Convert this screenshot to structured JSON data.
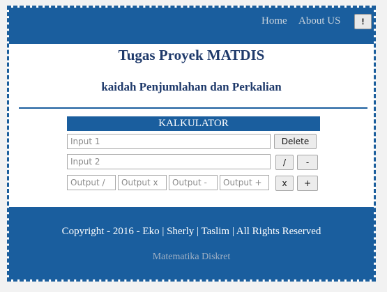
{
  "nav": {
    "home": "Home",
    "about": "About US",
    "info_button": "!"
  },
  "page": {
    "title": "Tugas Proyek MATDIS",
    "subtitle": "kaidah Penjumlahan dan Perkalian"
  },
  "calculator": {
    "header": "KALKULATOR",
    "input1_placeholder": "Input 1",
    "input2_placeholder": "Input 2",
    "delete_label": "Delete",
    "divide_label": "/",
    "subtract_label": "-",
    "multiply_label": "x",
    "add_label": "+",
    "outputs": {
      "divide": "Output /",
      "multiply": "Output x",
      "subtract": "Output -",
      "add": "Output +"
    }
  },
  "footer": {
    "copyright": "Copyright - 2016 - Eko | Sherly | Taslim | All Rights Reserved",
    "link": "Matematika Diskret"
  },
  "colors": {
    "primary": "#1a5e9e",
    "heading": "#1f3a6b"
  }
}
